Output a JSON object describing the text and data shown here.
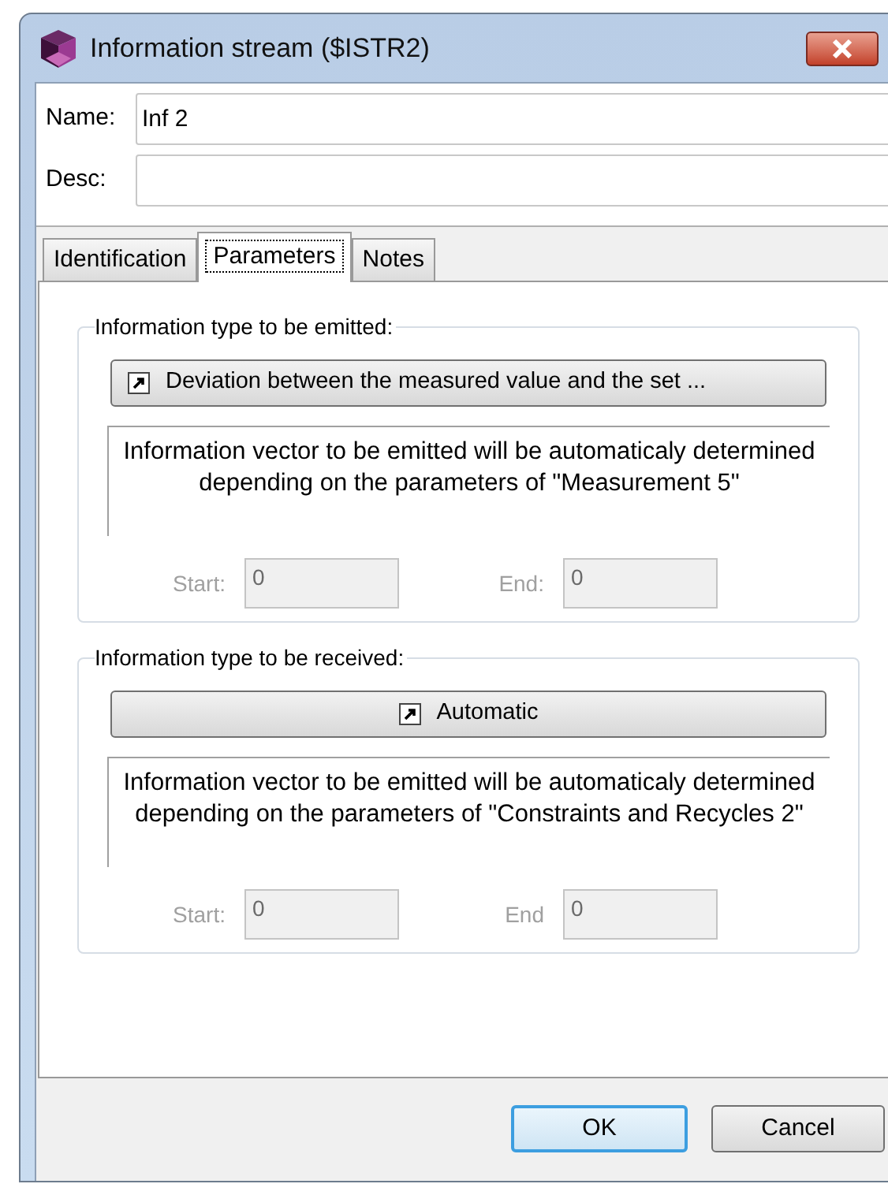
{
  "window": {
    "title": "Information stream ($ISTR2)"
  },
  "fields": [
    {
      "label": "Name:",
      "value": "Inf 2"
    },
    {
      "label": "Desc:"
    }
  ],
  "tabs": [
    {
      "label": "Identification",
      "selected": false
    },
    {
      "label": "Parameters",
      "selected": true
    },
    {
      "label": "Notes",
      "selected": false
    }
  ],
  "groups": [
    {
      "title": "Information type to be emitted:",
      "button": {
        "label": "Deviation between the measured value and the set ...",
        "kind": "choice"
      },
      "message": "Information vector to be emitted will be automaticaly determined depending on the parameters of \"Measurement 5\"",
      "start": {
        "label": "Start:",
        "value": "0",
        "disabled": true
      },
      "end": {
        "label": "End:",
        "value": "0",
        "disabled": true
      }
    },
    {
      "title": "Information type to be received:",
      "button": {
        "label": "Automatic",
        "kind": "auto"
      },
      "message": "Information vector to be emitted will be automaticaly determined depending on the parameters of \"Constraints and Recycles 2\"",
      "start": {
        "label": "Start:",
        "value": "0",
        "disabled": true
      },
      "end": {
        "label": "End",
        "value": "0",
        "disabled": true
      }
    }
  ],
  "buttons": [
    {
      "label": "OK",
      "default": true
    },
    {
      "label": "Cancel",
      "default": false
    }
  ]
}
